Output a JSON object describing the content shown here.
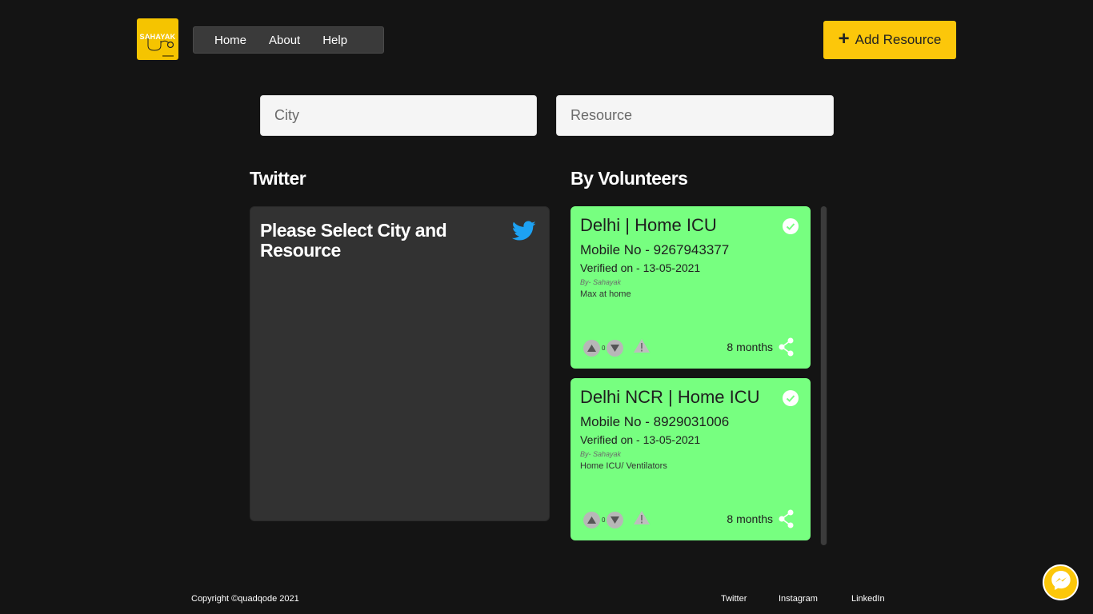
{
  "header": {
    "logo_text": "SAHAYAK",
    "nav": [
      "Home",
      "About",
      "Help"
    ],
    "add_resource_label": "Add Resource"
  },
  "search": {
    "city_placeholder": "City",
    "resource_placeholder": "Resource"
  },
  "twitter": {
    "heading": "Twitter",
    "message": "Please Select City and Resource"
  },
  "volunteers": {
    "heading": "By Volunteers",
    "cards": [
      {
        "title": "Delhi | Home ICU",
        "mobile": "Mobile No - 9267943377",
        "verified": "Verified on - 13-05-2021",
        "by": "By- Sahayak",
        "note": "Max at home",
        "votes": "0",
        "age": "8 months"
      },
      {
        "title": "Delhi NCR | Home ICU",
        "mobile": "Mobile No - 8929031006",
        "verified": "Verified on - 13-05-2021",
        "by": "By- Sahayak",
        "note": "Home ICU/ Ventilators",
        "votes": "0",
        "age": "8 months"
      }
    ]
  },
  "footer": {
    "copyright": "Copyright ©quadqode 2021",
    "links": [
      "Twitter",
      "Instagram",
      "LinkedIn"
    ]
  },
  "colors": {
    "accent": "#fcc70a",
    "card": "#77ff80",
    "background": "#141414",
    "twitter_blue": "#1da1f2"
  },
  "icons": [
    "plus-icon",
    "twitter-bird-icon",
    "verified-check-icon",
    "upvote-icon",
    "downvote-icon",
    "report-warning-icon",
    "share-icon",
    "messenger-icon"
  ]
}
